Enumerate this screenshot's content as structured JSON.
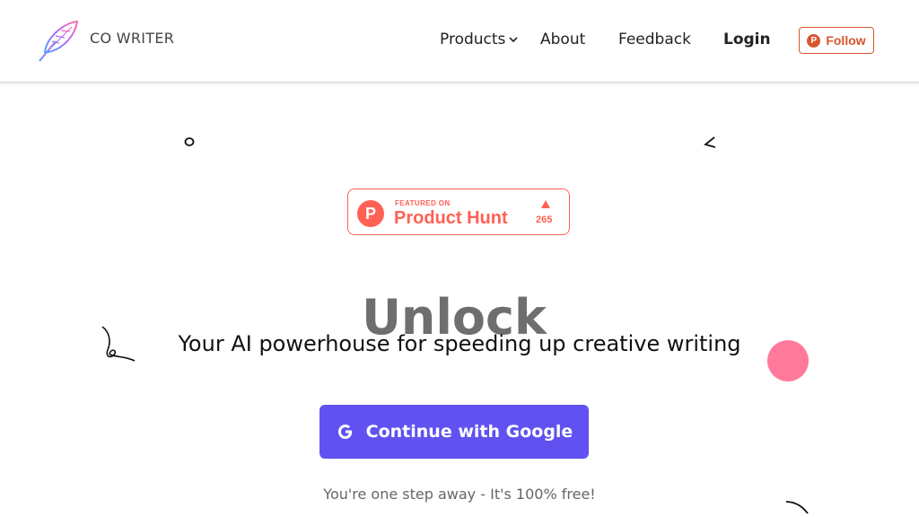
{
  "header": {
    "brand": "CO WRITER",
    "logo_icon": "feather-icon",
    "nav": {
      "products": "Products",
      "about": "About",
      "feedback": "Feedback",
      "login": "Login"
    },
    "follow_label": "Follow",
    "follow_icon_letter": "P"
  },
  "product_hunt": {
    "featured_text": "FEATURED ON",
    "name": "Product Hunt",
    "icon_letter": "P",
    "upvotes": "265"
  },
  "hero": {
    "animated_word": "Unlock",
    "tagline": "Your AI powerhouse for speeding up creative writing",
    "cta_label": "Continue with Google",
    "cta_icon_letter": "G",
    "subtext": "You're one step away - It's 100% free!"
  },
  "colors": {
    "accent": "#6051f0",
    "product_hunt": "#ff6154",
    "decor_dot": "#ff7a9a"
  }
}
